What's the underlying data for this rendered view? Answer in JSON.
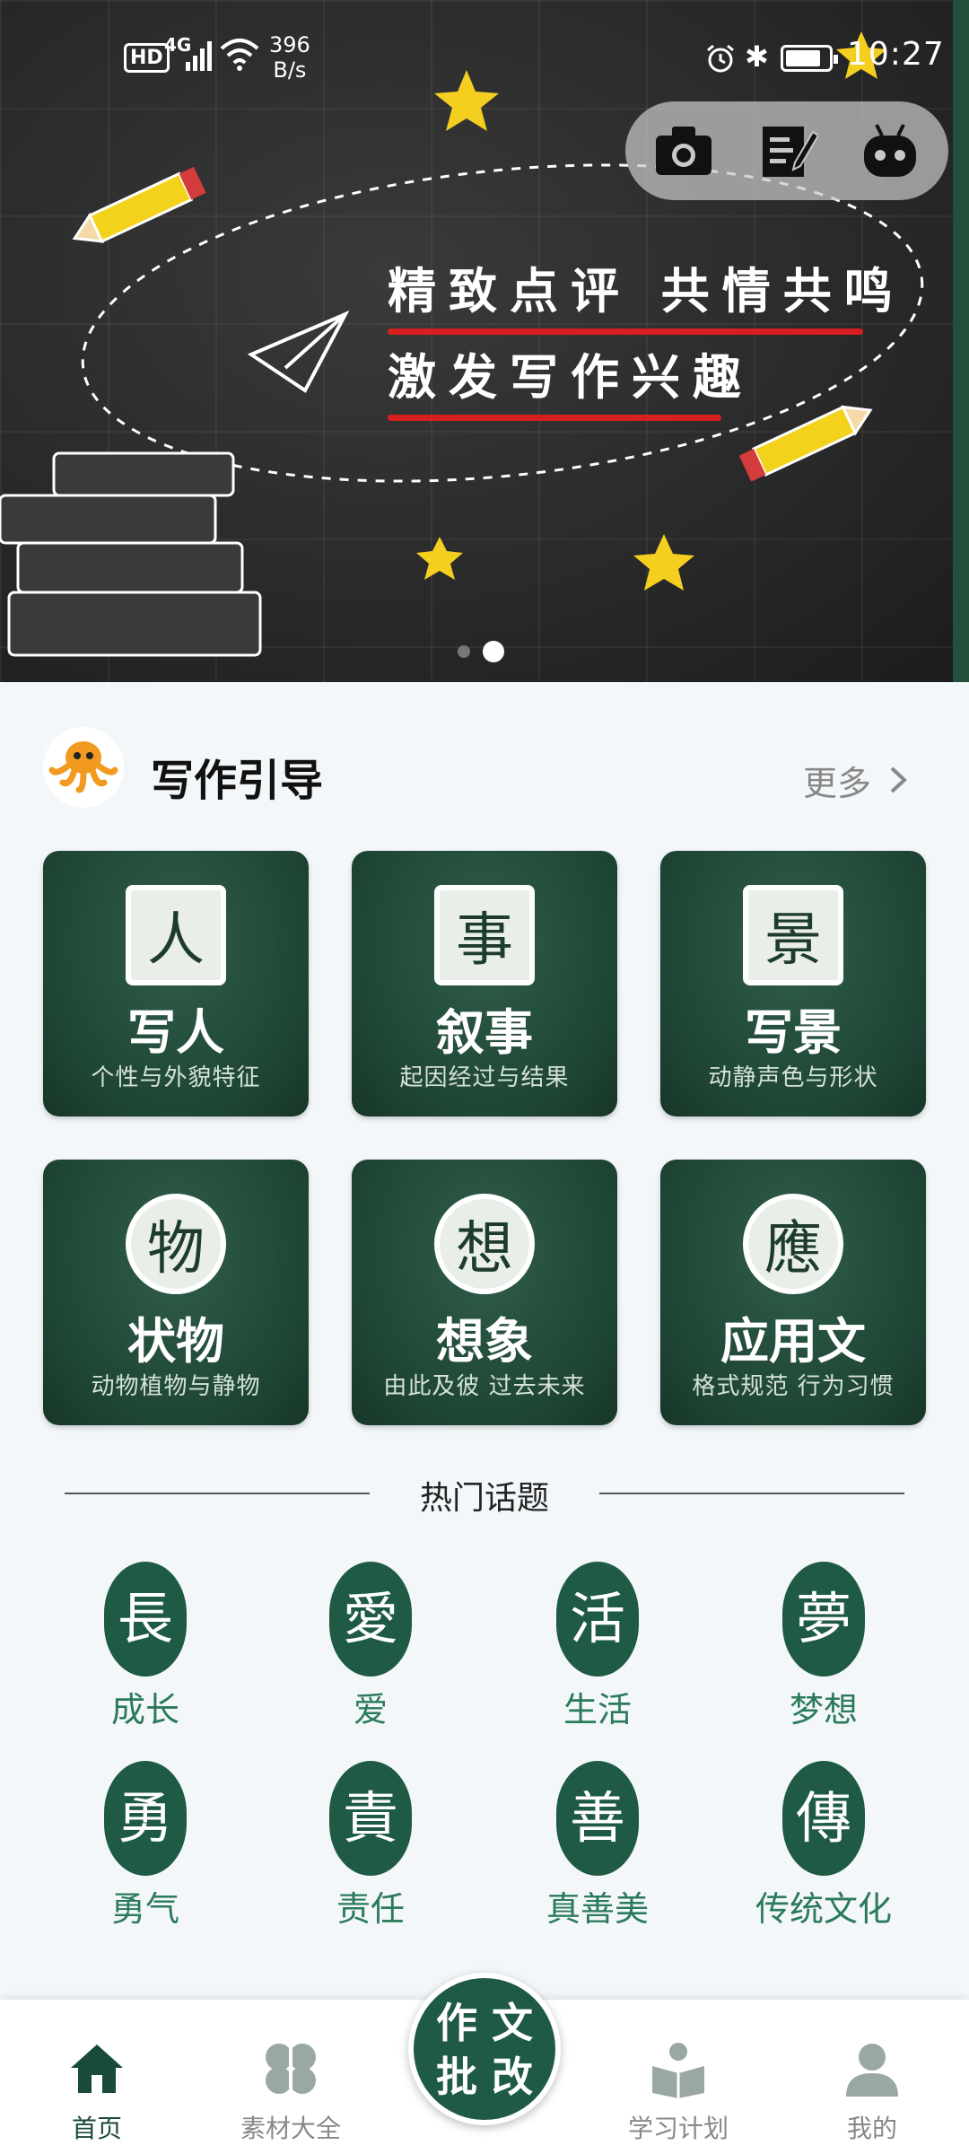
{
  "status_bar": {
    "hd": "HD",
    "network": "4G",
    "speed_value": "396",
    "speed_unit": "B/s",
    "time": "10:27"
  },
  "banner": {
    "line1": "精致点评 共情共鸣",
    "line2": "激发写作兴趣",
    "page_count": 2,
    "active_page": 2
  },
  "floating_bar": {
    "icons": [
      "camera-icon",
      "edit-note-icon",
      "robot-icon"
    ]
  },
  "section": {
    "title": "写作引导",
    "more": "更多"
  },
  "categories": [
    {
      "name": "写人",
      "sub": "个性与外貌特征",
      "seal": "人",
      "seal_shape": "square"
    },
    {
      "name": "叙事",
      "sub": "起因经过与结果",
      "seal": "事",
      "seal_shape": "square"
    },
    {
      "name": "写景",
      "sub": "动静声色与形状",
      "seal": "景",
      "seal_shape": "square"
    },
    {
      "name": "状物",
      "sub": "动物植物与静物",
      "seal": "物",
      "seal_shape": "round"
    },
    {
      "name": "想象",
      "sub": "由此及彼 过去未来",
      "seal": "想",
      "seal_shape": "round"
    },
    {
      "name": "应用文",
      "sub": "格式规范 行为习惯",
      "seal": "應",
      "seal_shape": "round"
    }
  ],
  "hot_topics": {
    "title": "热门话题",
    "items": [
      {
        "label": "成长",
        "stamp": "長"
      },
      {
        "label": "爱",
        "stamp": "愛"
      },
      {
        "label": "生活",
        "stamp": "活"
      },
      {
        "label": "梦想",
        "stamp": "夢"
      },
      {
        "label": "勇气",
        "stamp": "勇"
      },
      {
        "label": "责任",
        "stamp": "責"
      },
      {
        "label": "真善美",
        "stamp": "善"
      },
      {
        "label": "传统文化",
        "stamp": "傳"
      }
    ]
  },
  "bottom_nav": {
    "items": [
      {
        "label": "首页",
        "icon": "home-icon",
        "active": true
      },
      {
        "label": "素材大全",
        "icon": "clover-icon",
        "active": false
      },
      {
        "label": "学习计划",
        "icon": "reading-icon",
        "active": false
      },
      {
        "label": "我的",
        "icon": "user-icon",
        "active": false
      }
    ],
    "center_button": {
      "line1": "作 文",
      "line2": "批 改"
    }
  },
  "colors": {
    "primary": "#1f5a44",
    "banner_bg": "#2a2a2a",
    "underline": "#d81f1f",
    "page_bg": "#f3f7f9"
  }
}
